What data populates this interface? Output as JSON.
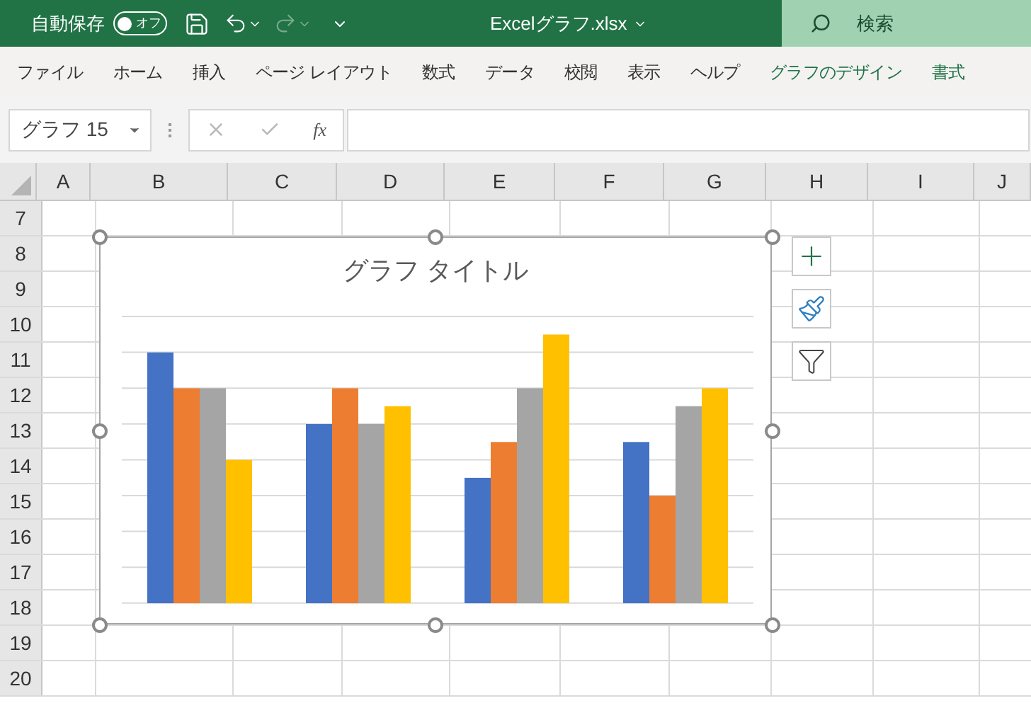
{
  "title_bar": {
    "autosave_label": "自動保存",
    "autosave_toggle": {
      "label": "オフ",
      "on": false
    },
    "filename": "Excelグラフ.xlsx",
    "search": {
      "placeholder": "検索"
    }
  },
  "ribbon_tabs": [
    {
      "label": "ファイル",
      "kind": "normal"
    },
    {
      "label": "ホーム",
      "kind": "normal"
    },
    {
      "label": "挿入",
      "kind": "normal"
    },
    {
      "label": "ページ レイアウト",
      "kind": "normal"
    },
    {
      "label": "数式",
      "kind": "normal"
    },
    {
      "label": "データ",
      "kind": "normal"
    },
    {
      "label": "校閲",
      "kind": "normal"
    },
    {
      "label": "表示",
      "kind": "normal"
    },
    {
      "label": "ヘルプ",
      "kind": "normal"
    },
    {
      "label": "グラフのデザイン",
      "kind": "contextual"
    },
    {
      "label": "書式",
      "kind": "contextual"
    }
  ],
  "formula_bar": {
    "name_box": "グラフ 15",
    "function_label": "fx"
  },
  "sheet": {
    "columns": [
      "A",
      "B",
      "C",
      "D",
      "E",
      "F",
      "G",
      "H",
      "I",
      "J"
    ],
    "rows": [
      "7",
      "8",
      "9",
      "10",
      "11",
      "12",
      "13",
      "14",
      "15",
      "16",
      "17",
      "18",
      "19",
      "20"
    ]
  },
  "chart": {
    "title": "グラフ タイトル",
    "selected": true
  }
}
